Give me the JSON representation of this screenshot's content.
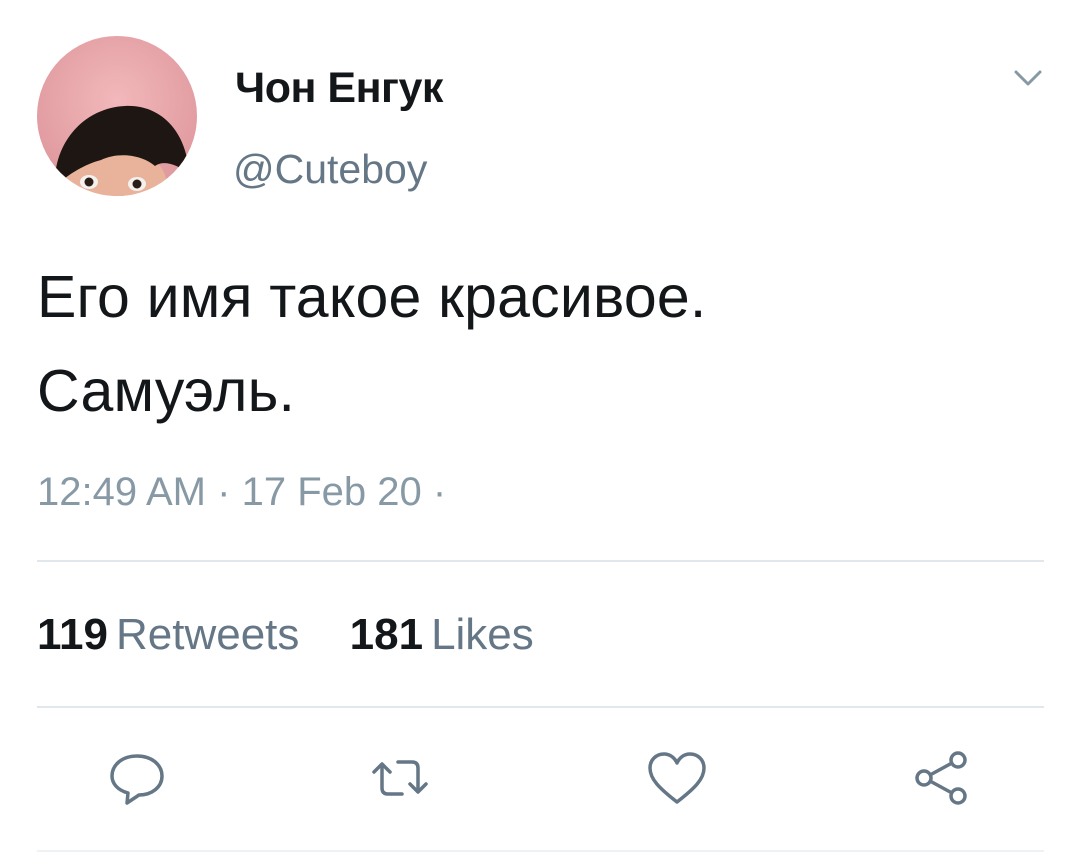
{
  "tweet": {
    "author": {
      "display_name": "Чон Енгук",
      "handle": "@Cuteboy",
      "avatar_icon": "profile-photo"
    },
    "text_lines": [
      "Его имя такое красивое.",
      "Самуэль."
    ],
    "meta": {
      "time": "12:49 AM",
      "date": "17 Feb 20",
      "separator": "·"
    },
    "stats": {
      "retweets_count": "119",
      "retweets_label": "Retweets",
      "likes_count": "181",
      "likes_label": "Likes"
    },
    "actions": [
      {
        "icon": "reply-icon"
      },
      {
        "icon": "retweet-icon"
      },
      {
        "icon": "heart-icon"
      },
      {
        "icon": "share-icon"
      }
    ]
  },
  "colors": {
    "primary_text": "#14171a",
    "secondary_text": "#657786",
    "meta_text": "#8899a6",
    "divider": "#e1e8ed",
    "avatar_background": "#e8a3a8"
  }
}
